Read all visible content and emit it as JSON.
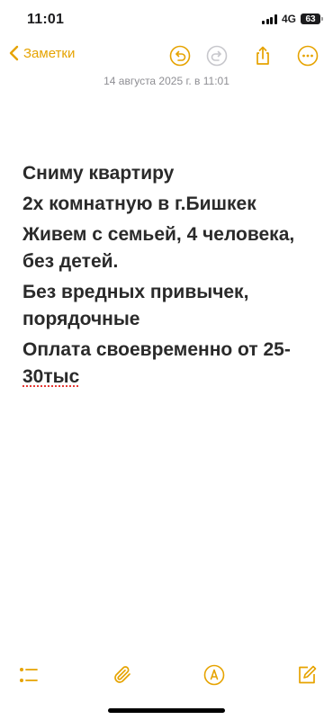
{
  "status_bar": {
    "time": "11:01",
    "network": "4G",
    "battery": "63"
  },
  "nav": {
    "back_label": "Заметки"
  },
  "note": {
    "timestamp": "14 августа 2025 г. в 11:01",
    "lines": [
      "Сниму квартиру",
      "2х комнатную в г.Бишкек",
      "Живем с семьей, 4 человека, без детей.",
      "Без вредных привычек, порядочные",
      "Оплата своевременно от 25-"
    ],
    "misspelled": "30тыс"
  },
  "colors": {
    "accent": "#e6a300",
    "secondary_text": "#8e8e93",
    "spellcheck": "#e53935"
  },
  "icons": {
    "back": "chevron-left-icon",
    "undo": "undo-icon",
    "redo": "redo-icon",
    "share": "share-icon",
    "more": "more-icon",
    "checklist": "checklist-icon",
    "attachment": "paperclip-icon",
    "markup": "markup-pen-icon",
    "compose": "compose-icon"
  }
}
